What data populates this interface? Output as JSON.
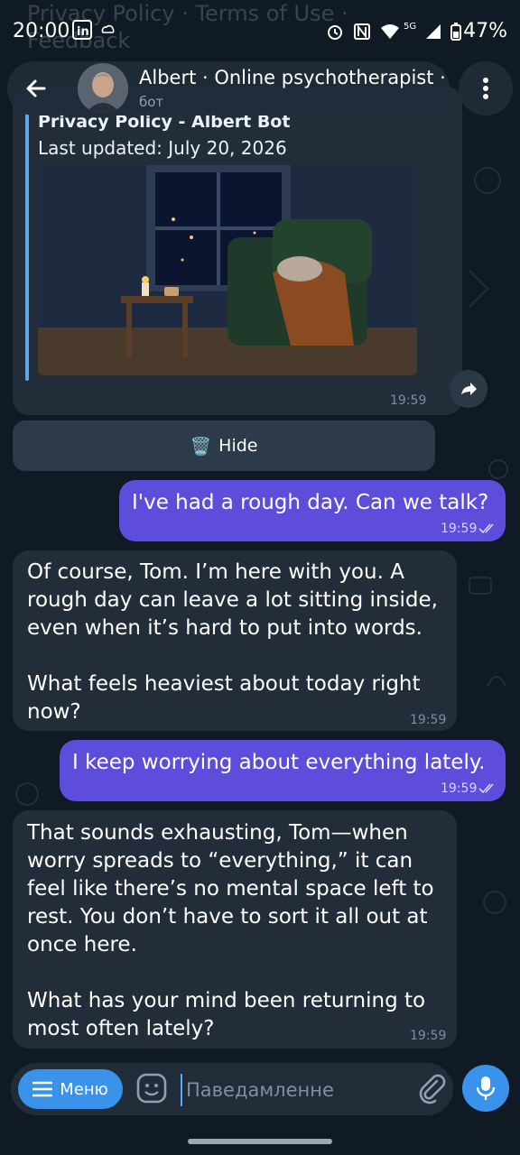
{
  "status_bar": {
    "time": "20:00",
    "battery": "47%",
    "network": "5G"
  },
  "top_overlay_text": {
    "line1": "Privacy Policy · Terms of Use ·",
    "line2": "Feedback"
  },
  "header": {
    "title": "Albert · Online psychotherapist ·",
    "subtitle": "бот"
  },
  "link_preview": {
    "title": "Privacy Policy - Albert Bot",
    "updated": "Last updated: July 20, 2026",
    "time": "19:59"
  },
  "hide_button": {
    "icon": "🗑️",
    "label": "Hide"
  },
  "messages": [
    {
      "side": "out",
      "text": "I've had a rough day. Can we talk?",
      "time": "19:59"
    },
    {
      "side": "in",
      "text": "Of course, Tom. I’m here with you. A\nrough day can leave a lot sitting inside,\neven when it’s hard to put into words.\n\nWhat feels heaviest about today right\nnow?",
      "time": "19:59"
    },
    {
      "side": "out",
      "text": "I keep worrying about everything lately.",
      "time": "19:59"
    },
    {
      "side": "in",
      "text": "That sounds exhausting, Tom—when\nworry spreads to “everything,” it can\nfeel like there’s no mental space left to\nrest. You don’t have to sort it all out at\nonce here.\n\nWhat has your mind been returning to\nmost often lately?",
      "time": "19:59"
    }
  ],
  "composer": {
    "menu_label": "Меню",
    "placeholder": "Паведамленне"
  }
}
